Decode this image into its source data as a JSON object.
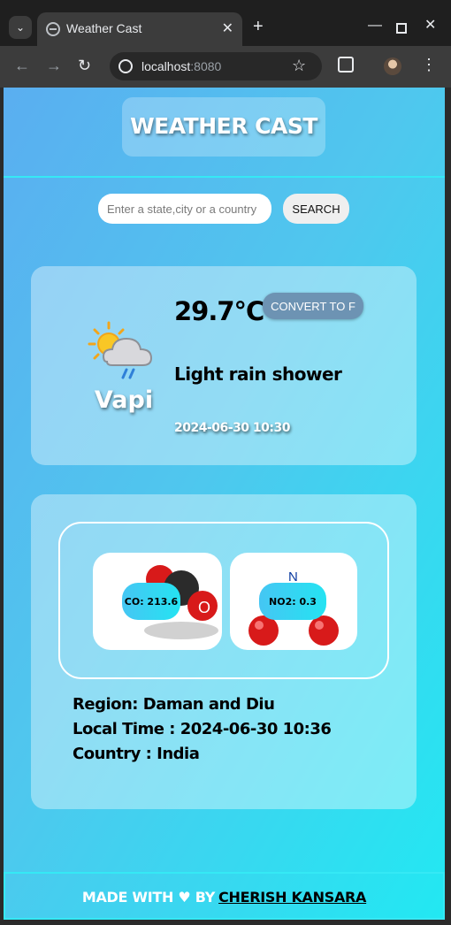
{
  "browser": {
    "tab_title": "Weather Cast",
    "url_host": "localhost",
    "url_port": ":8080",
    "icons": [
      "tab-search-icon",
      "globe-icon",
      "close-icon",
      "new-tab-icon",
      "minimize-icon",
      "maximize-icon",
      "window-close-icon",
      "back-icon",
      "forward-icon",
      "reload-icon",
      "site-info-icon",
      "bookmark-star-icon",
      "extensions-icon",
      "profile-avatar",
      "kebab-menu-icon"
    ]
  },
  "header": {
    "title": "WEATHER CAST"
  },
  "search": {
    "placeholder": "Enter a state,city or a country",
    "value": "",
    "button_label": "SEARCH"
  },
  "current": {
    "temp": "29.7°C",
    "convert_label": "CONVERT TO F",
    "condition": "Light rain shower",
    "city": "Vapi",
    "observed_at": "2024-06-30 10:30",
    "icon": "sun-cloud-rain-icon"
  },
  "air_quality": {
    "co_label": "CO: 213.6",
    "no2_label": "NO2: 0.3",
    "co_icon": "co-molecule",
    "no2_icon": "no2-molecule",
    "no2_atom_label": "N",
    "co_atom_label": "O"
  },
  "location": {
    "region": "Region: Daman and Diu",
    "local_time": "Local Time : 2024-06-30 10:36",
    "country": "Country : India"
  },
  "footer": {
    "text": "MADE WITH ♥ BY",
    "author": "CHERISH KANSARA"
  },
  "colors": {
    "gradient_start": "#5aaef0",
    "gradient_end": "#22e8f2",
    "accent_border": "#35e9f5",
    "convert_button": "#6d93b3"
  }
}
